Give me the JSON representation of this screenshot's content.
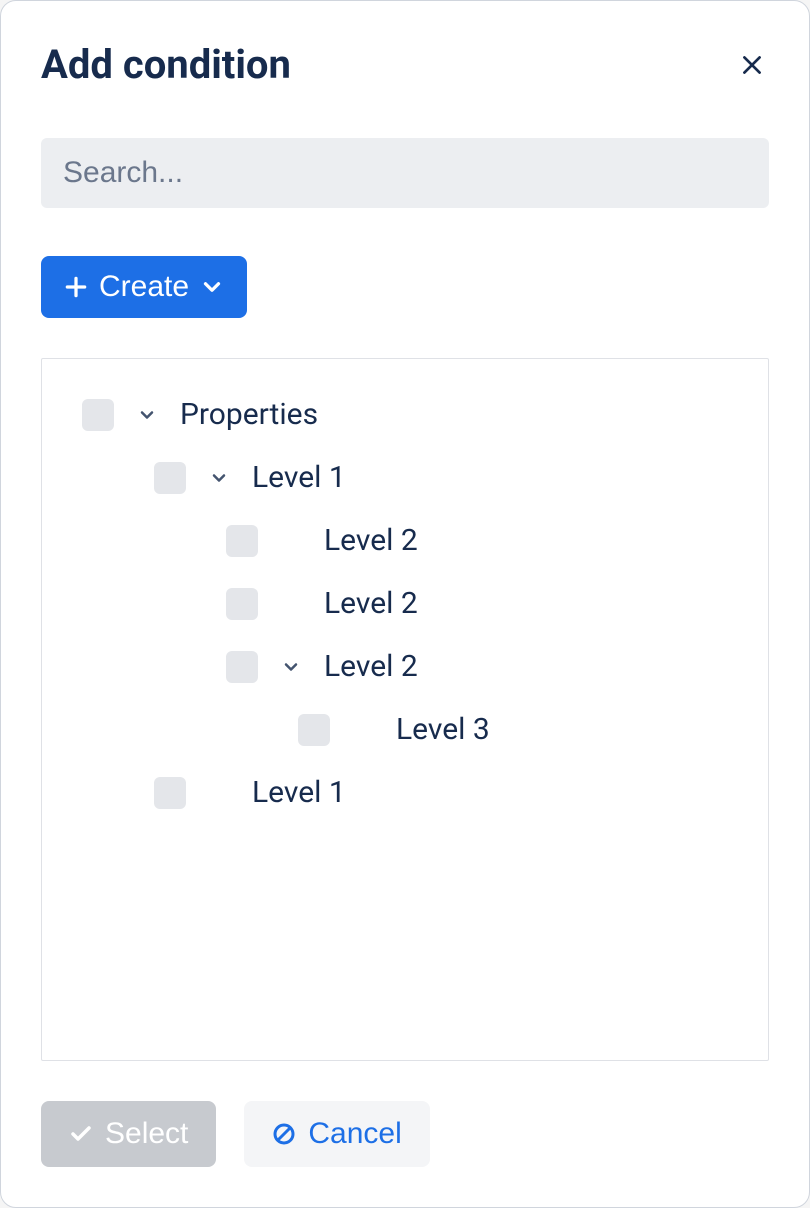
{
  "modal": {
    "title": "Add condition",
    "search": {
      "placeholder": "Search..."
    },
    "create_button": {
      "label": "Create"
    },
    "tree": {
      "items": [
        {
          "label": "Properties",
          "indent": 0,
          "expandable": true
        },
        {
          "label": "Level 1",
          "indent": 1,
          "expandable": true
        },
        {
          "label": "Level 2",
          "indent": 2,
          "expandable": false
        },
        {
          "label": "Level 2",
          "indent": 2,
          "expandable": false
        },
        {
          "label": "Level 2",
          "indent": 2,
          "expandable": true
        },
        {
          "label": "Level 3",
          "indent": 3,
          "expandable": false
        },
        {
          "label": "Level 1",
          "indent": 1,
          "expandable": false
        }
      ]
    },
    "footer": {
      "select_label": "Select",
      "cancel_label": "Cancel"
    }
  }
}
